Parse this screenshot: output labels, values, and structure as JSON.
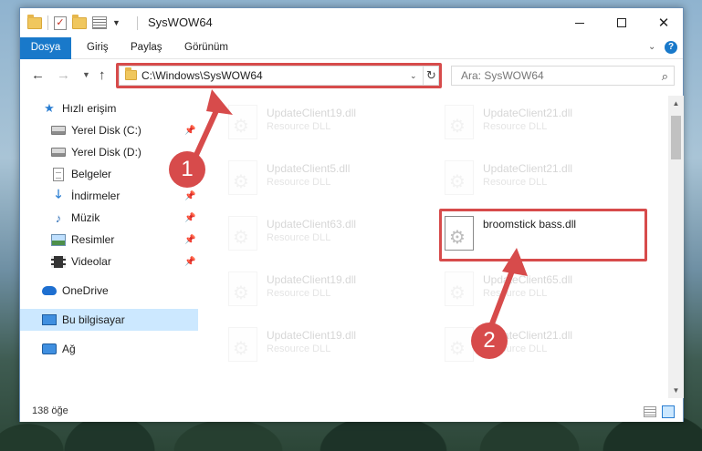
{
  "window": {
    "title": "SysWOW64",
    "minimize_icon": "minimize-icon",
    "maximize_icon": "maximize-icon",
    "close_symbol": "✕"
  },
  "ribbon": {
    "tabs": [
      "Dosya",
      "Giriş",
      "Paylaş",
      "Görünüm"
    ],
    "help_label": "?"
  },
  "nav": {
    "address": "C:\\Windows\\SysWOW64",
    "search_placeholder": "Ara: SysWOW64"
  },
  "sidebar": {
    "items": [
      {
        "label": "Hızlı erişim",
        "icon": "star-icon"
      },
      {
        "label": "Yerel Disk (C:)",
        "icon": "drive-icon",
        "pinned": true
      },
      {
        "label": "Yerel Disk (D:)",
        "icon": "drive-icon",
        "pinned": true
      },
      {
        "label": "Belgeler",
        "icon": "document-icon",
        "pinned": true
      },
      {
        "label": "İndirmeler",
        "icon": "download-icon",
        "pinned": true
      },
      {
        "label": "Müzik",
        "icon": "music-icon",
        "pinned": true
      },
      {
        "label": "Resimler",
        "icon": "pictures-icon",
        "pinned": true
      },
      {
        "label": "Videolar",
        "icon": "videos-icon",
        "pinned": true
      },
      {
        "label": "OneDrive",
        "icon": "onedrive-icon"
      },
      {
        "label": "Bu bilgisayar",
        "icon": "computer-icon",
        "selected": true
      },
      {
        "label": "Ağ",
        "icon": "network-icon"
      }
    ]
  },
  "files": [
    {
      "name": "UpdateClient19.dll",
      "type": "Resource DLL"
    },
    {
      "name": "UpdateClient21.dll",
      "type": "Resource DLL"
    },
    {
      "name": "UpdateClient5.dll",
      "type": "Resource DLL"
    },
    {
      "name": "UpdateClient21.dll",
      "type": "Resource DLL"
    },
    {
      "name": "UpdateClient63.dll",
      "type": "Resource DLL"
    },
    {
      "name": "broomstick bass.dll",
      "type": ""
    },
    {
      "name": "UpdateClient19.dll",
      "type": "Resource DLL"
    },
    {
      "name": "UpdateClient65.dll",
      "type": "Resource DLL"
    },
    {
      "name": "UpdateClient19.dll",
      "type": "Resource DLL"
    },
    {
      "name": "UpdateClient21.dll",
      "type": "Resource DLL"
    }
  ],
  "status": {
    "item_count": "138 öğe"
  },
  "annotations": {
    "step1": "1",
    "step2": "2",
    "color": "#d74b4b"
  },
  "colors": {
    "accent": "#1979ca",
    "selection": "#cce8ff"
  }
}
